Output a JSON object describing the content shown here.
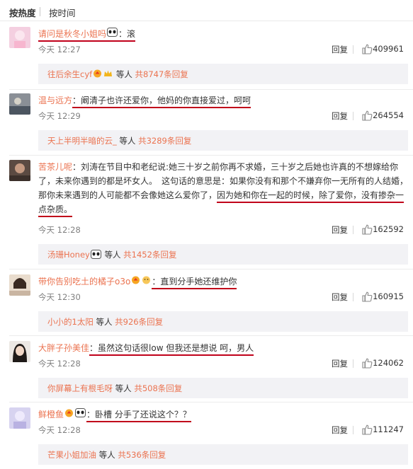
{
  "tabs": {
    "hot": "按热度",
    "time": "按时间"
  },
  "labels": {
    "reply": "回复",
    "sub_mid": "等人",
    "sub_total": "共",
    "sub_suffix": "条回复"
  },
  "comments": [
    {
      "user": "请问是秋冬小姐吗",
      "content": "：滚",
      "time": "今天 12:27",
      "likes": "409961",
      "sub_user": "往后余生cyf",
      "sub_count": "8747"
    },
    {
      "user": "温与远方",
      "content": "：阚清子也许还爱你，他妈的你直接爱过，呵呵",
      "time": "今天 12:29",
      "likes": "264554",
      "sub_user": "天上半明半暗的云_",
      "sub_count": "3289"
    },
    {
      "user": "苦茶儿呢",
      "content_a": "：刘涛在节目中和老纪说:她三十岁之前你再不求婚，三十岁之后她也许真的不想嫁给你了，未来你遇到的都是坏女人。　这句话的意思是：如果你没有和那个不嫌弃你一无所有的人结婚，那你未来遇到的人可能都不会像她这么爱你了，",
      "content_b": "因为她和你在一起的时候，除了爱你，没有掺杂一点杂质。",
      "time": "今天 12:28",
      "likes": "162592",
      "sub_user": "汤珊Honey",
      "sub_count": "1452"
    },
    {
      "user": "带你告别吃土的橘子o3o",
      "content": "：直到分手她还维护你",
      "time": "今天 12:30",
      "likes": "160915",
      "sub_user": "小小的1太阳",
      "sub_count": "926"
    },
    {
      "user": "大胖子孙美佳",
      "content": "：虽然这句话很low  但我还是想说  呵，男人",
      "time": "今天 12:28",
      "likes": "124062",
      "sub_user": "你屏幕上有根毛呀",
      "sub_count": "508"
    },
    {
      "user": "鲜橙鱼",
      "content": "：卧槽 分手了还说这个？？",
      "time": "今天 12:28",
      "likes": "111247",
      "sub_user": "芒果小姐加油",
      "sub_count": "536"
    }
  ],
  "colors": {
    "username": "#eb7350",
    "underline": "#c0001a",
    "subbar": "#f2f2f5"
  }
}
